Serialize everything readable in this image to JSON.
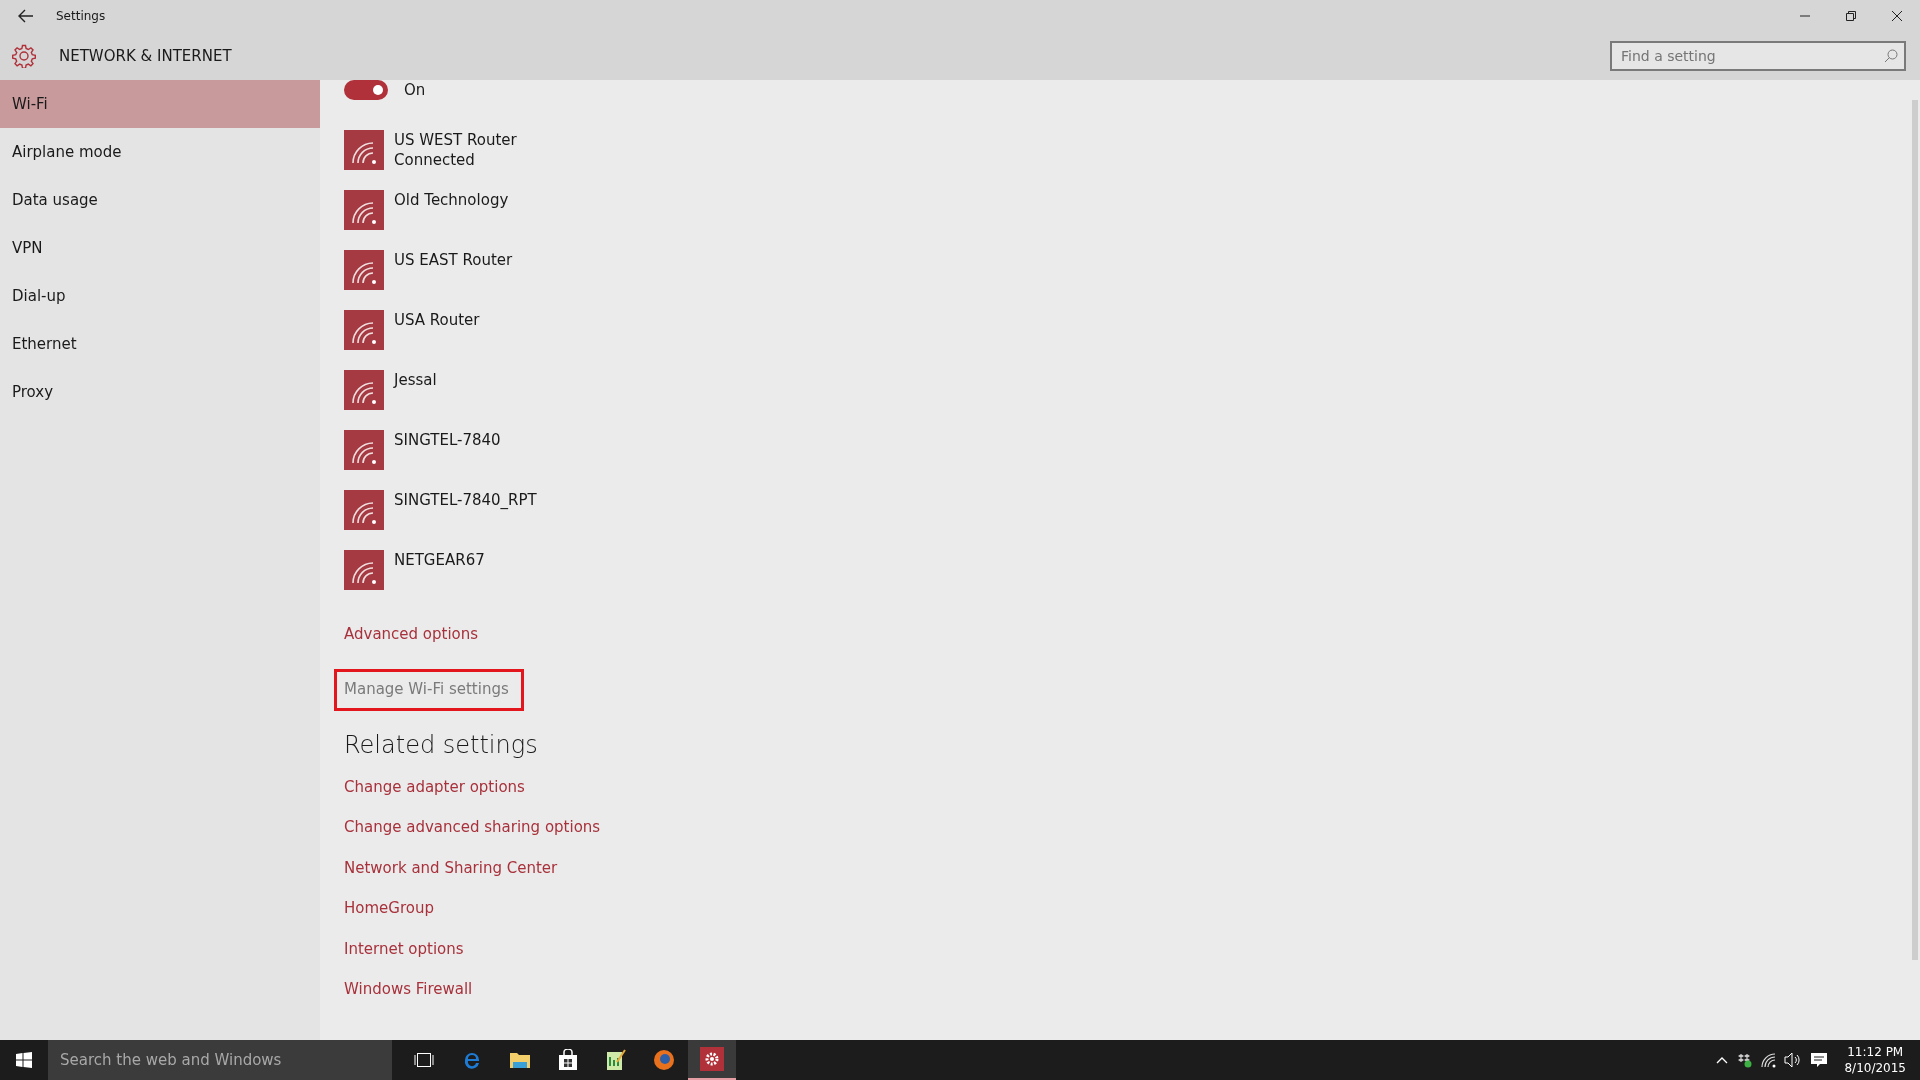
{
  "window": {
    "title": "Settings"
  },
  "header": {
    "title": "NETWORK & INTERNET",
    "search": {
      "placeholder": "Find a setting"
    }
  },
  "sidebar": {
    "items": [
      {
        "label": "Wi-Fi",
        "selected": true
      },
      {
        "label": "Airplane mode",
        "selected": false
      },
      {
        "label": "Data usage",
        "selected": false
      },
      {
        "label": "VPN",
        "selected": false
      },
      {
        "label": "Dial-up",
        "selected": false
      },
      {
        "label": "Ethernet",
        "selected": false
      },
      {
        "label": "Proxy",
        "selected": false
      }
    ]
  },
  "wifi_toggle": {
    "on": true,
    "label": "On"
  },
  "networks": [
    {
      "name": "US WEST Router",
      "status": "Connected"
    },
    {
      "name": "Old Technology"
    },
    {
      "name": "US EAST Router"
    },
    {
      "name": "USA Router"
    },
    {
      "name": "Jessal"
    },
    {
      "name": "SINGTEL-7840"
    },
    {
      "name": "SINGTEL-7840_RPT"
    },
    {
      "name": "NETGEAR67"
    }
  ],
  "links": [
    {
      "label": "Advanced options",
      "disabled": false,
      "highlighted": false
    },
    {
      "label": "Manage Wi-Fi settings",
      "disabled": true,
      "highlighted": true
    }
  ],
  "related": {
    "title": "Related settings",
    "links": [
      "Change adapter options",
      "Change advanced sharing options",
      "Network and Sharing Center",
      "HomeGroup",
      "Internet options",
      "Windows Firewall"
    ]
  },
  "taskbar": {
    "search_placeholder": "Search the web and Windows",
    "time": "11:12 PM",
    "date": "8/10/2015"
  }
}
